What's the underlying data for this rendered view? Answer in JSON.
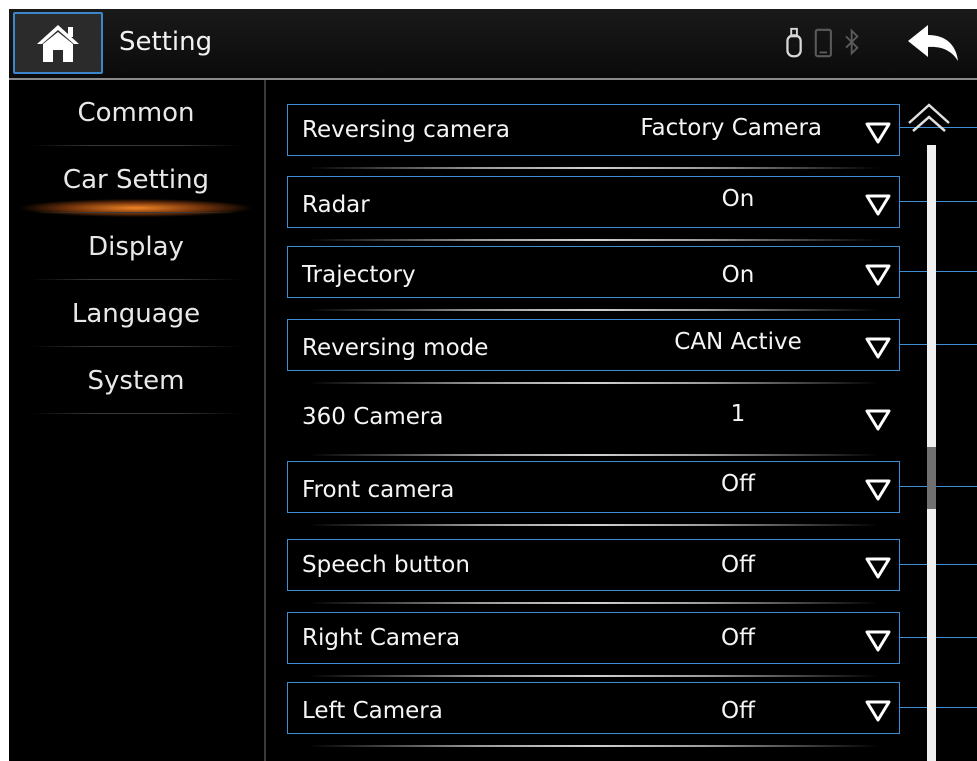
{
  "header": {
    "title": "Setting",
    "icons": [
      "home-icon",
      "usb-icon",
      "phone-icon",
      "bluetooth-icon",
      "back-arrow-icon"
    ]
  },
  "sidebar": {
    "items": [
      {
        "label": "Common",
        "active": false
      },
      {
        "label": "Car Setting",
        "active": true
      },
      {
        "label": "Display",
        "active": false
      },
      {
        "label": "Language",
        "active": false
      },
      {
        "label": "System",
        "active": false
      }
    ]
  },
  "settings": {
    "rows": [
      {
        "label": "Reversing camera",
        "value": "Factory Camera"
      },
      {
        "label": "Radar",
        "value": "On"
      },
      {
        "label": "Trajectory",
        "value": "On"
      },
      {
        "label": "Reversing mode",
        "value": "CAN Active"
      },
      {
        "label": "360 Camera",
        "value": "1"
      },
      {
        "label": "Front camera",
        "value": "Off"
      },
      {
        "label": "Speech button",
        "value": "Off"
      },
      {
        "label": "Right Camera",
        "value": "Off"
      },
      {
        "label": "Left Camera",
        "value": "Off"
      }
    ]
  },
  "colors": {
    "accent_border": "#3e8ed6",
    "active_glow": "#ff8c28",
    "background": "#000000",
    "text": "#f5f5f5"
  }
}
